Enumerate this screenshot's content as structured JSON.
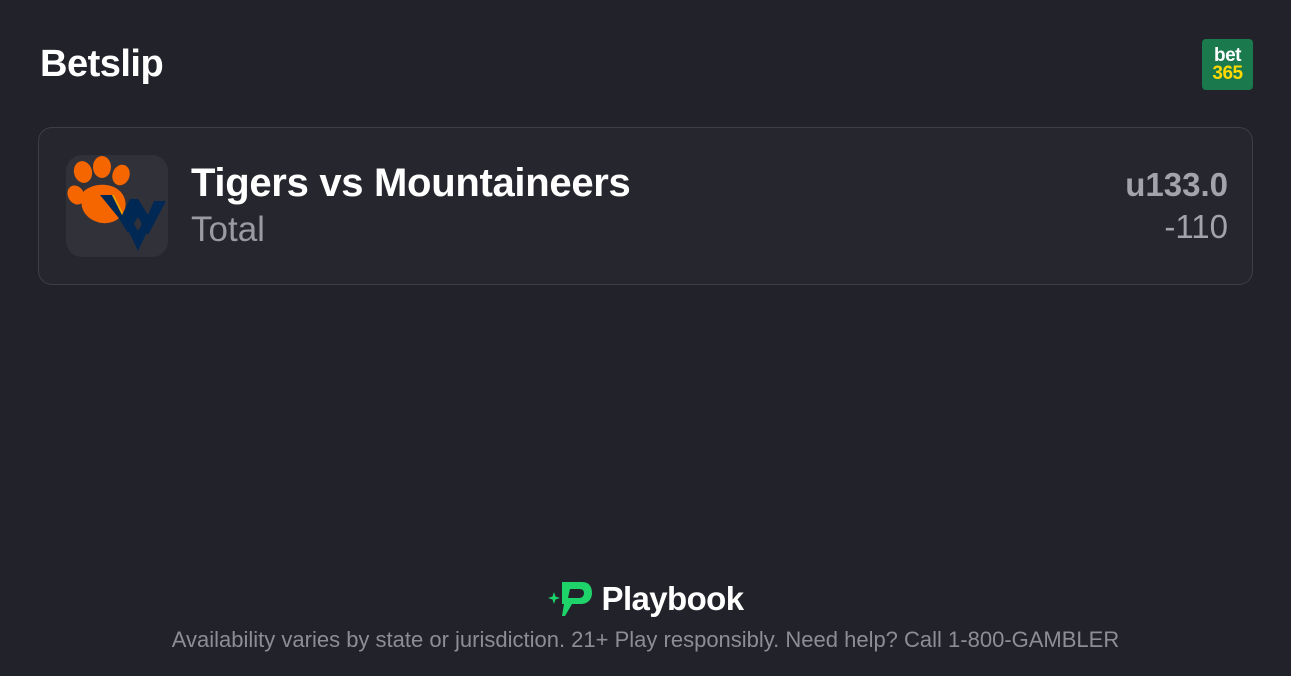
{
  "header": {
    "title": "Betslip",
    "sportsbook": {
      "line1": "bet",
      "line2": "365",
      "bg_color": "#1b7a4d",
      "accent_color": "#ffd900"
    }
  },
  "bet": {
    "matchup": "Tigers vs Mountaineers",
    "market": "Total",
    "line": "u133.0",
    "odds": "-110",
    "logo_icons": [
      "tiger-paw-icon",
      "wv-flying-wv-icon"
    ]
  },
  "footer": {
    "brand_name": "Playbook",
    "brand_color": "#1fd36b",
    "disclaimer": "Availability varies by state or jurisdiction. 21+ Play responsibly. Need help? Call 1-800-GAMBLER"
  }
}
